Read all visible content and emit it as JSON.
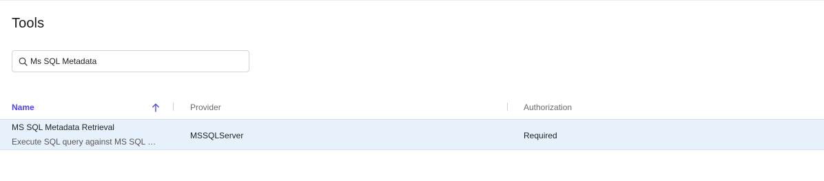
{
  "page": {
    "title": "Tools"
  },
  "search": {
    "value": "Ms SQL Metadata",
    "icon": "search-icon"
  },
  "table": {
    "columns": [
      {
        "label": "Name",
        "sorted": "ascending",
        "active": true
      },
      {
        "label": "Provider"
      },
      {
        "label": "Authorization"
      }
    ],
    "rows": [
      {
        "name": "MS SQL Metadata Retrieval",
        "description": "Execute SQL query against MS SQL Server",
        "provider": "MSSQLServer",
        "authorization": "Required",
        "selected": true
      }
    ]
  },
  "colors": {
    "accent": "#4f46e5",
    "row_highlight": "#e7f1fc",
    "muted_text": "#6b6b6b"
  }
}
